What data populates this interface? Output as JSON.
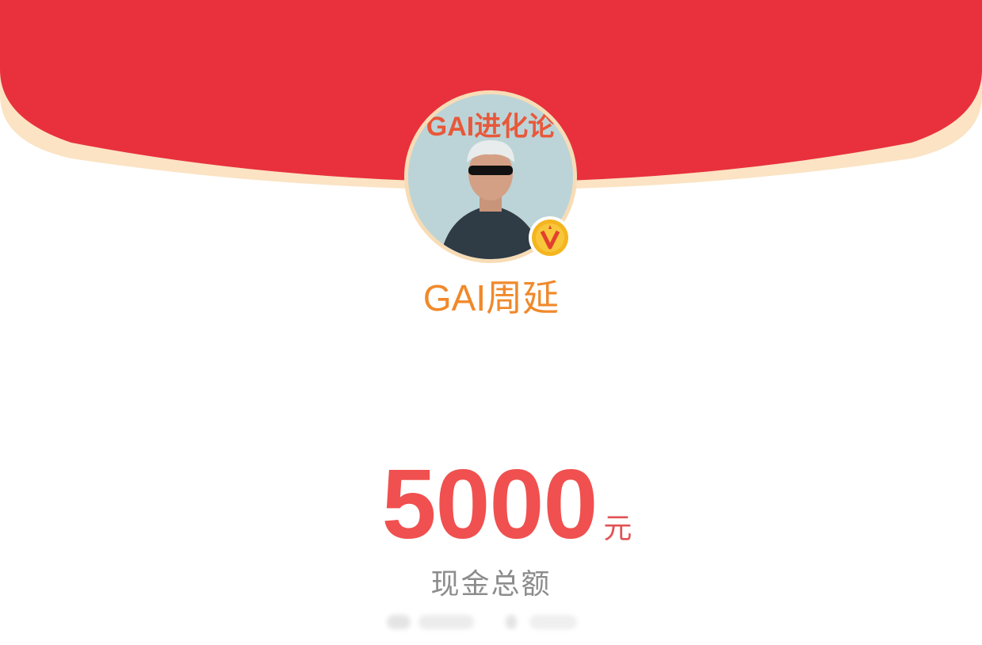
{
  "header": {
    "envelope_color": "#e8313d",
    "rim_color": "#fbe3c3"
  },
  "profile": {
    "name": "GAI周延",
    "avatar": {
      "description_icon": "profile-photo",
      "cover_text": "GAI进化论"
    },
    "verified_badge_icon": "verified-v-icon",
    "name_color": "#f0892b"
  },
  "reward": {
    "amount": "5000",
    "unit": "元",
    "label": "现金总额",
    "amount_color": "#f0504f"
  }
}
